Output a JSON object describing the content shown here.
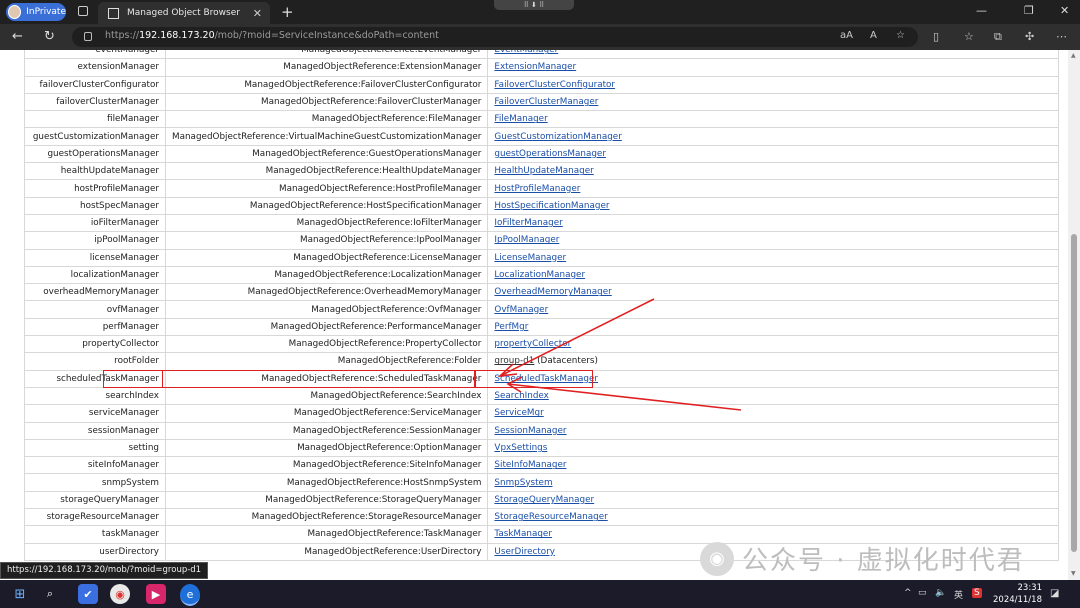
{
  "browser": {
    "profile_label": "InPrivate",
    "tab_title": "Managed Object Browser",
    "tab_close": "✕",
    "new_tab": "+",
    "url_prefix": "https://",
    "url_host": "192.168.173.20",
    "url_path": "/mob/?moid=ServiceInstance&doPath=content",
    "status_url": "https://192.168.173.20/mob/?moid=group-d1"
  },
  "rows": [
    {
      "name": "eventManager",
      "type": "ManagedObjectReference:EventManager",
      "value": "EventManager"
    },
    {
      "name": "extensionManager",
      "type": "ManagedObjectReference:ExtensionManager",
      "value": "ExtensionManager"
    },
    {
      "name": "failoverClusterConfigurator",
      "type": "ManagedObjectReference:FailoverClusterConfigurator",
      "value": "FailoverClusterConfigurator"
    },
    {
      "name": "failoverClusterManager",
      "type": "ManagedObjectReference:FailoverClusterManager",
      "value": "FailoverClusterManager"
    },
    {
      "name": "fileManager",
      "type": "ManagedObjectReference:FileManager",
      "value": "FileManager"
    },
    {
      "name": "guestCustomizationManager",
      "type": "ManagedObjectReference:VirtualMachineGuestCustomizationManager",
      "value": "GuestCustomizationManager"
    },
    {
      "name": "guestOperationsManager",
      "type": "ManagedObjectReference:GuestOperationsManager",
      "value": "guestOperationsManager"
    },
    {
      "name": "healthUpdateManager",
      "type": "ManagedObjectReference:HealthUpdateManager",
      "value": "HealthUpdateManager"
    },
    {
      "name": "hostProfileManager",
      "type": "ManagedObjectReference:HostProfileManager",
      "value": "HostProfileManager"
    },
    {
      "name": "hostSpecManager",
      "type": "ManagedObjectReference:HostSpecificationManager",
      "value": "HostSpecificationManager"
    },
    {
      "name": "ioFilterManager",
      "type": "ManagedObjectReference:IoFilterManager",
      "value": "IoFilterManager"
    },
    {
      "name": "ipPoolManager",
      "type": "ManagedObjectReference:IpPoolManager",
      "value": "IpPoolManager"
    },
    {
      "name": "licenseManager",
      "type": "ManagedObjectReference:LicenseManager",
      "value": "LicenseManager"
    },
    {
      "name": "localizationManager",
      "type": "ManagedObjectReference:LocalizationManager",
      "value": "LocalizationManager"
    },
    {
      "name": "overheadMemoryManager",
      "type": "ManagedObjectReference:OverheadMemoryManager",
      "value": "OverheadMemoryManager"
    },
    {
      "name": "ovfManager",
      "type": "ManagedObjectReference:OvfManager",
      "value": "OvfManager"
    },
    {
      "name": "perfManager",
      "type": "ManagedObjectReference:PerformanceManager",
      "value": "PerfMgr"
    },
    {
      "name": "propertyCollector",
      "type": "ManagedObjectReference:PropertyCollector",
      "value": "propertyCollector"
    },
    {
      "name": "rootFolder",
      "type": "ManagedObjectReference:Folder",
      "value": "group-d1",
      "value_suffix": " (Datacenters)"
    },
    {
      "name": "scheduledTaskManager",
      "type": "ManagedObjectReference:ScheduledTaskManager",
      "value": "ScheduledTaskManager"
    },
    {
      "name": "searchIndex",
      "type": "ManagedObjectReference:SearchIndex",
      "value": "SearchIndex"
    },
    {
      "name": "serviceManager",
      "type": "ManagedObjectReference:ServiceManager",
      "value": "ServiceMgr"
    },
    {
      "name": "sessionManager",
      "type": "ManagedObjectReference:SessionManager",
      "value": "SessionManager"
    },
    {
      "name": "setting",
      "type": "ManagedObjectReference:OptionManager",
      "value": "VpxSettings"
    },
    {
      "name": "siteInfoManager",
      "type": "ManagedObjectReference:SiteInfoManager",
      "value": "SiteInfoManager"
    },
    {
      "name": "snmpSystem",
      "type": "ManagedObjectReference:HostSnmpSystem",
      "value": "SnmpSystem"
    },
    {
      "name": "storageQueryManager",
      "type": "ManagedObjectReference:StorageQueryManager",
      "value": "StorageQueryManager"
    },
    {
      "name": "storageResourceManager",
      "type": "ManagedObjectReference:StorageResourceManager",
      "value": "StorageResourceManager"
    },
    {
      "name": "taskManager",
      "type": "ManagedObjectReference:TaskManager",
      "value": "TaskManager"
    },
    {
      "name": "userDirectory",
      "type": "ManagedObjectReference:UserDirectory",
      "value": "UserDirectory"
    }
  ],
  "watermark": "公众号 · 虚拟化时代君",
  "taskbar": {
    "time": "23:31",
    "date": "2024/11/18",
    "ime": "英",
    "tray_chevron": "^"
  },
  "colors": {
    "link": "#1a4fa8",
    "highlight": "#e02020",
    "accent": "#3a6fd8"
  }
}
